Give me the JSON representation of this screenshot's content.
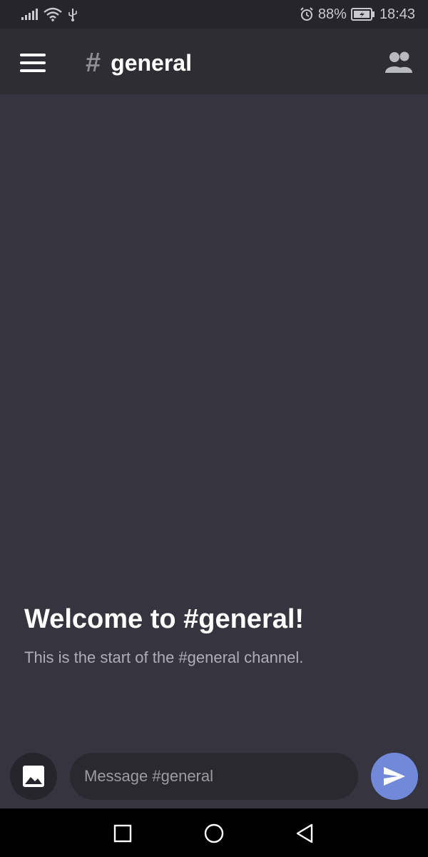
{
  "status_bar": {
    "battery": "88%",
    "time": "18:43",
    "icons": [
      "signal-icon",
      "wifi-icon",
      "usb-icon",
      "alarm-icon",
      "battery-charging-icon"
    ]
  },
  "app_bar": {
    "channel_prefix": "#",
    "channel_name": "general",
    "icons": [
      "menu-icon",
      "members-icon"
    ]
  },
  "welcome": {
    "title": "Welcome to #general!",
    "subtitle": "This is the start of the #general channel."
  },
  "composer": {
    "placeholder": "Message #general",
    "value": "",
    "icons": [
      "image-icon",
      "send-icon"
    ]
  },
  "nav_bar": {
    "icons": [
      "recents-icon",
      "home-icon",
      "back-icon"
    ]
  },
  "colors": {
    "background": "#36353f",
    "app_bar": "#2e2d34",
    "status_bar": "#25252b",
    "accent": "#7289da",
    "input_bg": "#2a2930"
  }
}
